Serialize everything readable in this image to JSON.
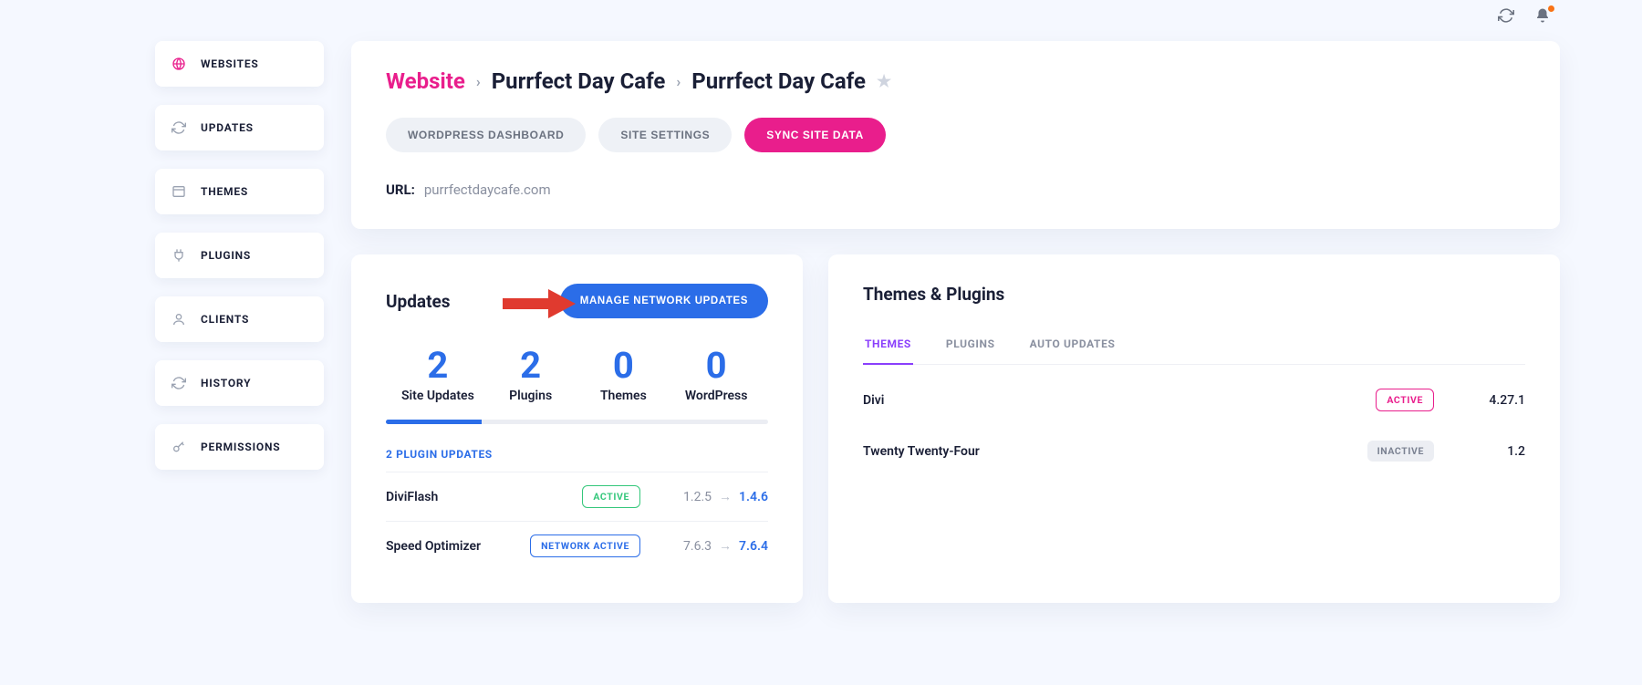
{
  "sidebar": {
    "items": [
      {
        "label": "WEBSITES",
        "icon": "globe-icon",
        "active": true
      },
      {
        "label": "UPDATES",
        "icon": "refresh-icon",
        "active": false
      },
      {
        "label": "THEMES",
        "icon": "layout-icon",
        "active": false
      },
      {
        "label": "PLUGINS",
        "icon": "plug-icon",
        "active": false
      },
      {
        "label": "CLIENTS",
        "icon": "user-icon",
        "active": false
      },
      {
        "label": "HISTORY",
        "icon": "refresh-icon",
        "active": false
      },
      {
        "label": "PERMISSIONS",
        "icon": "key-icon",
        "active": false
      }
    ]
  },
  "breadcrumb": {
    "root": "Website",
    "item1": "Purrfect Day Cafe",
    "item2": "Purrfect Day Cafe"
  },
  "headerButtons": {
    "wp": "WORDPRESS DASHBOARD",
    "settings": "SITE SETTINGS",
    "sync": "SYNC SITE DATA"
  },
  "url": {
    "label": "URL:",
    "value": "purrfectdaycafe.com"
  },
  "updatesPanel": {
    "title": "Updates",
    "manageBtn": "MANAGE NETWORK UPDATES",
    "stats": [
      {
        "num": "2",
        "label": "Site Updates"
      },
      {
        "num": "2",
        "label": "Plugins"
      },
      {
        "num": "0",
        "label": "Themes"
      },
      {
        "num": "0",
        "label": "WordPress"
      }
    ],
    "progressPct": 25,
    "subheading": "2 PLUGIN UPDATES",
    "rows": [
      {
        "name": "DiviFlash",
        "badge": "ACTIVE",
        "badgeClass": "badge-green",
        "oldVer": "1.2.5",
        "newVer": "1.4.6"
      },
      {
        "name": "Speed Optimizer",
        "badge": "NETWORK ACTIVE",
        "badgeClass": "badge-blue",
        "oldVer": "7.6.3",
        "newVer": "7.6.4"
      }
    ]
  },
  "tpPanel": {
    "title": "Themes & Plugins",
    "tabs": [
      {
        "label": "THEMES",
        "active": true
      },
      {
        "label": "PLUGINS",
        "active": false
      },
      {
        "label": "AUTO UPDATES",
        "active": false
      }
    ],
    "rows": [
      {
        "name": "Divi",
        "badge": "ACTIVE",
        "badgeClass": "badge badge-pink",
        "ver": "4.27.1"
      },
      {
        "name": "Twenty Twenty-Four",
        "badge": "INACTIVE",
        "badgeClass": "badge badge-grey",
        "ver": "1.2"
      }
    ]
  },
  "colors": {
    "pink": "#e91e8c",
    "blue": "#2b6de8",
    "purple": "#8a3ffc",
    "green": "#34c77b"
  }
}
